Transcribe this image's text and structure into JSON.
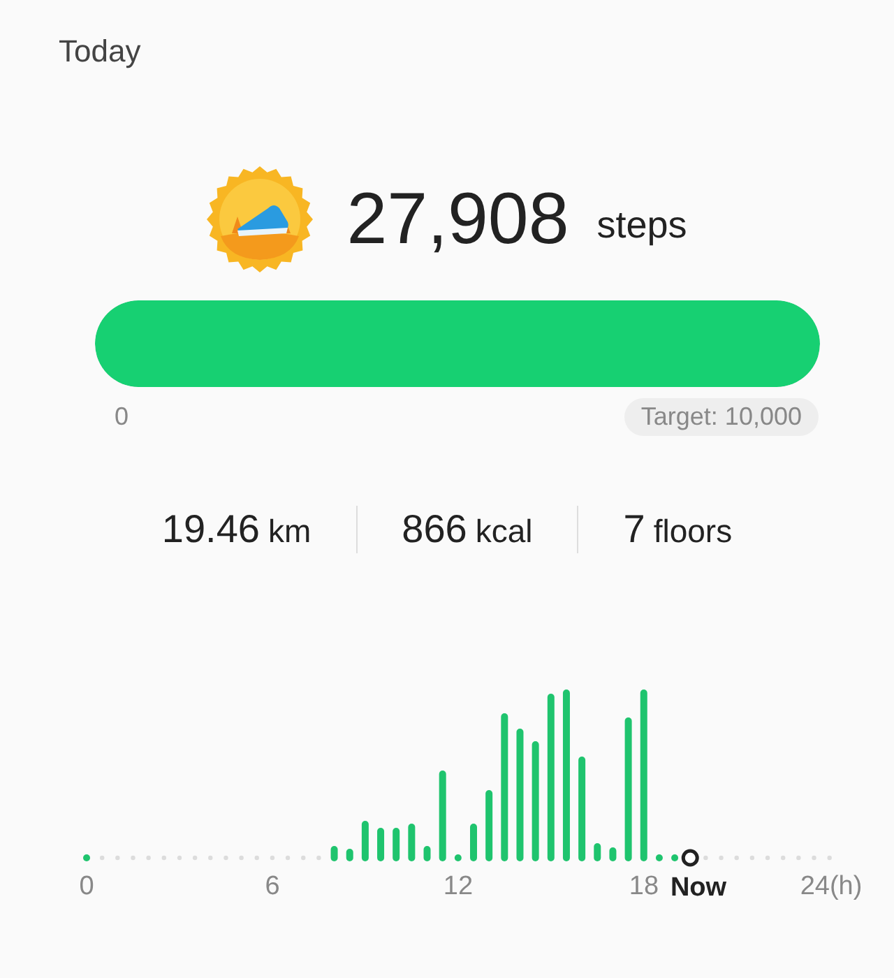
{
  "title": "Today",
  "steps": {
    "value": "27,908",
    "unit": "steps"
  },
  "progress": {
    "level": 1,
    "start_label": "0",
    "target_label": "Target: 10,000"
  },
  "stats": [
    {
      "value": "19.46",
      "unit": "km"
    },
    {
      "value": "866",
      "unit": "kcal"
    },
    {
      "value": "7",
      "unit": "floors"
    }
  ],
  "timeline": {
    "axis_labels": [
      "0",
      "6",
      "12",
      "18"
    ],
    "now_label": "Now",
    "end_label": "24(h)"
  }
}
